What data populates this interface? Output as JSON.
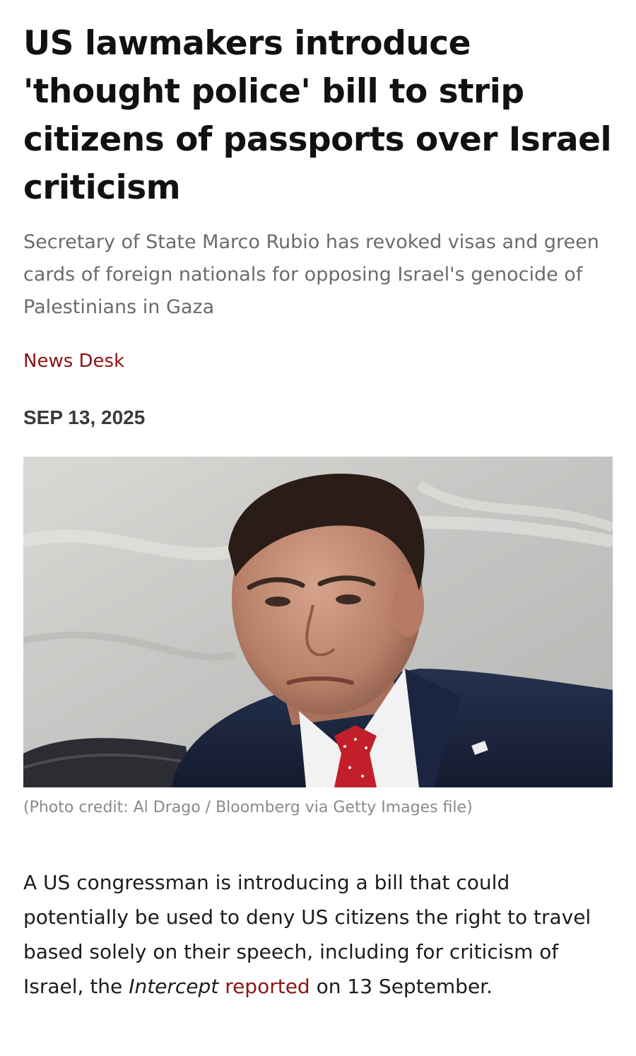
{
  "article": {
    "headline": "US lawmakers introduce 'thought police' bill to strip citizens of passports over Israel criticism",
    "subheadline": "Secretary of State Marco Rubio has revoked visas and green cards of foreign nationals for opposing Israel's genocide of Palestinians in Gaza",
    "author": "News Desk",
    "date": "SEP 13, 2025",
    "photo_caption": "(Photo credit: Al Drago / Bloomberg via Getty Images file)",
    "body": {
      "part1": "A US congressman is introducing a bill that could potentially be used to deny US citizens the right to travel based solely on their speech, including for criticism of Israel, the ",
      "publication": "Intercept",
      "link_text": "reported",
      "part2": " on 13 September."
    }
  },
  "colors": {
    "accent": "#8b1414",
    "headline": "#111111",
    "subheadline": "#6b6b6b",
    "caption": "#8a8a8a"
  }
}
